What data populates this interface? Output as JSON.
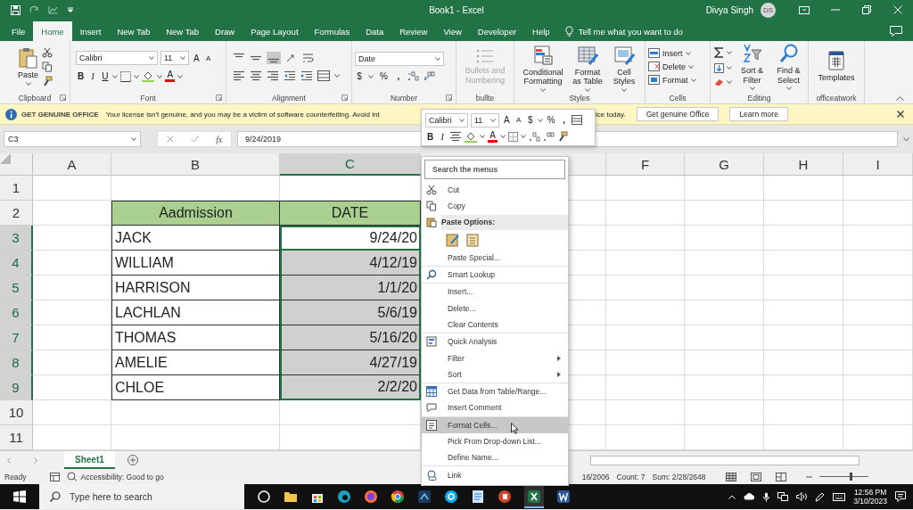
{
  "title_bar": {
    "title": "Book1  -  Excel",
    "user": "Divya Singh",
    "avatar": "DS"
  },
  "tabs": [
    {
      "label": "File",
      "selected": false
    },
    {
      "label": "Home",
      "selected": true
    },
    {
      "label": "Insert",
      "selected": false
    },
    {
      "label": "New Tab",
      "selected": false
    },
    {
      "label": "New Tab",
      "selected": false
    },
    {
      "label": "Draw",
      "selected": false
    },
    {
      "label": "Page Layout",
      "selected": false
    },
    {
      "label": "Formulas",
      "selected": false
    },
    {
      "label": "Data",
      "selected": false
    },
    {
      "label": "Review",
      "selected": false
    },
    {
      "label": "View",
      "selected": false
    },
    {
      "label": "Developer",
      "selected": false
    },
    {
      "label": "Help",
      "selected": false
    }
  ],
  "tell_me": {
    "placeholder": "Tell me what you want to do"
  },
  "ribbon": {
    "clipboard": {
      "label": "Clipboard",
      "paste": "Paste"
    },
    "font": {
      "label": "Font",
      "font_name": "Calibri",
      "font_size": "11",
      "grow": "A",
      "shrink": "A",
      "bold": "B",
      "italic": "I",
      "underline": "U",
      "font_color": "A"
    },
    "alignment": {
      "label": "Alignment"
    },
    "number": {
      "label": "Number",
      "format": "Date",
      "currency": "$",
      "percent": "%",
      "comma": ","
    },
    "bullets": {
      "label": "bullte",
      "button": "Bullets and Numbering",
      "disabled": true
    },
    "styles": {
      "label": "Styles",
      "buttons": [
        "Conditional Formatting",
        "Format as Table",
        "Cell Styles"
      ]
    },
    "cells": {
      "label": "Cells",
      "buttons": [
        "Insert",
        "Delete",
        "Format"
      ]
    },
    "editing": {
      "label": "Editing",
      "buttons": [
        "Sort & Filter",
        "Find & Select"
      ]
    },
    "officeatwork": {
      "label": "officeatwork",
      "button": "Templates"
    }
  },
  "info_bar": {
    "title": "GET GENUINE OFFICE",
    "message": "Your license isn't genuine, and you may be a victim of software counterfeiting. Avoid int",
    "message_tail": "ice today.",
    "buttons": [
      "Get genuine Office",
      "Learn more"
    ]
  },
  "formula_bar": {
    "name_box": "C3",
    "function_label": "fx",
    "value": "9/24/2019"
  },
  "mini_toolbar": {
    "font_name": "Calibri",
    "font_size": "11",
    "grow": "A",
    "shrink": "A",
    "currency": "$",
    "percent": "%",
    "comma": ",",
    "bold": "B",
    "italic": "I",
    "font_color": "A"
  },
  "sheet": {
    "columns": [
      {
        "label": "A",
        "selected": false
      },
      {
        "label": "B",
        "selected": false
      },
      {
        "label": "C",
        "selected": true
      },
      {
        "label": "F",
        "selected": false
      },
      {
        "label": "G",
        "selected": false
      },
      {
        "label": "H",
        "selected": false
      },
      {
        "label": "I",
        "selected": false
      }
    ],
    "rows": [
      {
        "label": "1",
        "kind": "empty",
        "selected": false
      },
      {
        "label": "2",
        "kind": "header",
        "selected": false,
        "cells": [
          "Aadmission",
          "DATE"
        ]
      },
      {
        "label": "3",
        "kind": "data",
        "selected": true,
        "cells": [
          "JACK",
          "9/24/20"
        ]
      },
      {
        "label": "4",
        "kind": "data",
        "selected": true,
        "cells": [
          "WILLIAM",
          "4/12/19"
        ]
      },
      {
        "label": "5",
        "kind": "data",
        "selected": true,
        "cells": [
          "HARRISON",
          "1/1/20"
        ]
      },
      {
        "label": "6",
        "kind": "data",
        "selected": true,
        "cells": [
          "LACHLAN",
          "5/6/19"
        ]
      },
      {
        "label": "7",
        "kind": "data",
        "selected": true,
        "cells": [
          "THOMAS",
          "5/16/20"
        ]
      },
      {
        "label": "8",
        "kind": "data",
        "selected": true,
        "cells": [
          "AMELIE",
          "4/27/19"
        ]
      },
      {
        "label": "9",
        "kind": "data",
        "selected": true,
        "cells": [
          "CHLOE",
          "2/2/20"
        ]
      },
      {
        "label": "10",
        "kind": "empty",
        "selected": false
      },
      {
        "label": "11",
        "kind": "empty",
        "selected": false
      }
    ]
  },
  "context_menu": {
    "search": {
      "placeholder": "Search the menus"
    },
    "sections": [
      {
        "items": [
          {
            "kind": "item",
            "label": "Cut",
            "selected": false,
            "submenu": false
          },
          {
            "kind": "item",
            "label": "Copy",
            "selected": false,
            "submenu": false
          },
          {
            "kind": "heading",
            "label": "Paste Options:"
          },
          {
            "kind": "paste-icons"
          },
          {
            "kind": "item",
            "label": "Paste Special...",
            "selected": false,
            "submenu": false
          }
        ]
      },
      {
        "items": [
          {
            "kind": "item",
            "label": "Smart Lookup",
            "selected": false,
            "submenu": false
          }
        ]
      },
      {
        "items": [
          {
            "kind": "item",
            "label": "Insert...",
            "selected": false,
            "submenu": false
          },
          {
            "kind": "item",
            "label": "Delete...",
            "selected": false,
            "submenu": false
          },
          {
            "kind": "item",
            "label": "Clear Contents",
            "selected": false,
            "submenu": false
          }
        ]
      },
      {
        "items": [
          {
            "kind": "item",
            "label": "Quick Analysis",
            "selected": false,
            "submenu": false
          },
          {
            "kind": "item",
            "label": "Filter",
            "selected": false,
            "submenu": true
          },
          {
            "kind": "item",
            "label": "Sort",
            "selected": false,
            "submenu": true
          }
        ]
      },
      {
        "items": [
          {
            "kind": "item",
            "label": "Get Data from Table/Range...",
            "selected": false,
            "submenu": false
          },
          {
            "kind": "item",
            "label": "Insert Comment",
            "selected": false,
            "submenu": false
          }
        ]
      },
      {
        "items": [
          {
            "kind": "item",
            "label": "Format Cells...",
            "selected": true,
            "submenu": false
          },
          {
            "kind": "item",
            "label": "Pick From Drop-down List...",
            "selected": false,
            "submenu": false
          },
          {
            "kind": "item",
            "label": "Define Name...",
            "selected": false,
            "submenu": false
          }
        ]
      },
      {
        "items": [
          {
            "kind": "item",
            "label": "Link",
            "selected": false,
            "submenu": false
          }
        ]
      }
    ]
  },
  "sheet_tabs": [
    {
      "label": "Sheet1",
      "selected": true
    }
  ],
  "status_bar": {
    "mode": "Ready",
    "accessibility": "Accessibility: Good to go",
    "average": "16/2006",
    "count": "Count: 7",
    "sum": "Sum: 2/28/2648",
    "zoom": {
      "level": 0.62
    }
  },
  "taskbar": {
    "search": {
      "placeholder": "Type here to search"
    },
    "time": "12:56 PM",
    "date": "3/10/2023"
  }
}
